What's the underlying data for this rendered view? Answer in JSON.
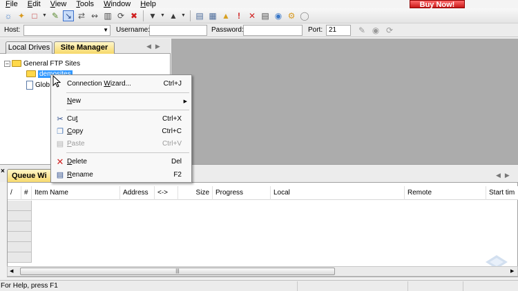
{
  "menubar": {
    "items": [
      {
        "label": "File",
        "key": "F",
        "rest": "ile"
      },
      {
        "label": "Edit",
        "key": "E",
        "rest": "dit"
      },
      {
        "label": "View",
        "key": "V",
        "rest": "iew"
      },
      {
        "label": "Tools",
        "key": "T",
        "rest": "ools"
      },
      {
        "label": "Window",
        "key": "W",
        "rest": "indow"
      },
      {
        "label": "Help",
        "key": "H",
        "rest": "elp"
      }
    ],
    "buy_now": "Buy Now!"
  },
  "quickconnect": {
    "host_label": "Host:",
    "host_value": "",
    "username_label": "Username:",
    "username_value": "",
    "password_label": "Password:",
    "password_value": "",
    "port_label": "Port:",
    "port_value": "21"
  },
  "left_tabs": {
    "local_drives": "Local Drives",
    "site_manager": "Site Manager"
  },
  "tree": {
    "root": "General FTP Sites",
    "child_selected": "demosites",
    "child_2": "Glob"
  },
  "context_menu": {
    "connection_wizard": {
      "pre": "Connection ",
      "key": "W",
      "post": "izard...",
      "shortcut": "Ctrl+J"
    },
    "new": {
      "key": "N",
      "post": "ew"
    },
    "cut": {
      "pre": "Cu",
      "key": "t",
      "post": "",
      "shortcut": "Ctrl+X"
    },
    "copy": {
      "key": "C",
      "post": "opy",
      "shortcut": "Ctrl+C"
    },
    "paste": {
      "key": "P",
      "post": "aste",
      "shortcut": "Ctrl+V"
    },
    "delete": {
      "key": "D",
      "post": "elete",
      "shortcut": "Del"
    },
    "rename": {
      "key": "R",
      "post": "ename",
      "shortcut": "F2"
    }
  },
  "queue": {
    "tab_label": "Queue Wi",
    "columns": [
      "/",
      "#",
      "Item Name",
      "Address",
      "<->",
      "Size",
      "Progress",
      "Local",
      "Remote",
      "Start tim"
    ]
  },
  "status": {
    "text": "For Help, press F1"
  }
}
